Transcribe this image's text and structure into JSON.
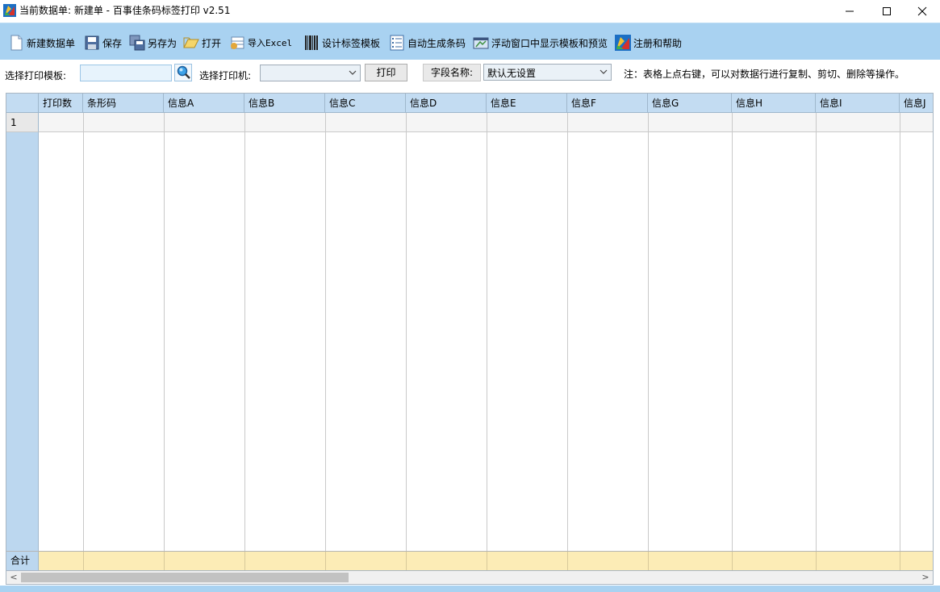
{
  "window": {
    "title": "当前数据单: 新建单 - 百事佳条码标签打印 v2.51",
    "minimize_glyph": "—",
    "maximize_glyph": "☐",
    "close_glyph": "✕"
  },
  "toolbar": {
    "items": [
      {
        "label": "新建数据单",
        "icon": "new-document-icon"
      },
      {
        "label": "保存",
        "icon": "save-icon"
      },
      {
        "label": "另存为",
        "icon": "save-as-icon"
      },
      {
        "label": "打开",
        "icon": "open-folder-icon"
      },
      {
        "label": "导入Excel",
        "icon": "import-excel-icon"
      },
      {
        "label": "设计标签模板",
        "icon": "barcode-icon"
      },
      {
        "label": "自动生成条码",
        "icon": "list-icon"
      },
      {
        "label": "浮动窗口中显示模板和预览",
        "icon": "preview-window-icon"
      },
      {
        "label": "注册和帮助",
        "icon": "help-icon"
      }
    ]
  },
  "options": {
    "template_label": "选择打印模板:",
    "template_value": "",
    "printer_label": "选择打印机:",
    "printer_value": "",
    "print_button": "打印",
    "field_name_label": "字段名称:",
    "field_name_value": "默认无设置",
    "note": "注：表格上点右键，可以对数据行进行复制、剪切、删除等操作。"
  },
  "grid": {
    "columns": [
      "打印数",
      "条形码",
      "信息A",
      "信息B",
      "信息C",
      "信息D",
      "信息E",
      "信息F",
      "信息G",
      "信息H",
      "信息I",
      "信息J"
    ],
    "rows": [
      {
        "number": "1",
        "cells": [
          "",
          "",
          "",
          "",
          "",
          "",
          "",
          "",
          "",
          "",
          "",
          ""
        ]
      }
    ],
    "total_label": "合计"
  },
  "scrollbar": {
    "left_glyph": "<",
    "right_glyph": ">"
  },
  "colors": {
    "toolbar_bg": "#a9d2f1",
    "header_bg": "#c3dcf2",
    "total_bg": "#fcecb6"
  }
}
